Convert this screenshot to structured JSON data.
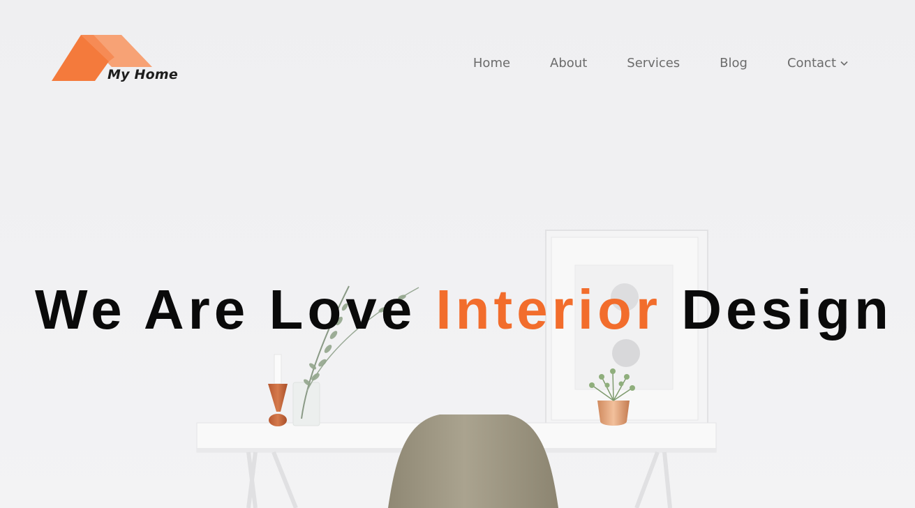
{
  "brand": {
    "name": "My Home",
    "roof_color_light": "#f7a275",
    "roof_color_dark": "#f47a3c"
  },
  "nav": {
    "items": [
      {
        "label": "Home"
      },
      {
        "label": "About"
      },
      {
        "label": "Services"
      },
      {
        "label": "Blog"
      },
      {
        "label": "Contact",
        "icon": "chevron-down-icon"
      }
    ]
  },
  "hero": {
    "headline_before": "We Are Love",
    "headline_accent": "Interior",
    "headline_after": "Design",
    "accent_color": "#f26d2c",
    "text_color": "#0a0a0a"
  }
}
